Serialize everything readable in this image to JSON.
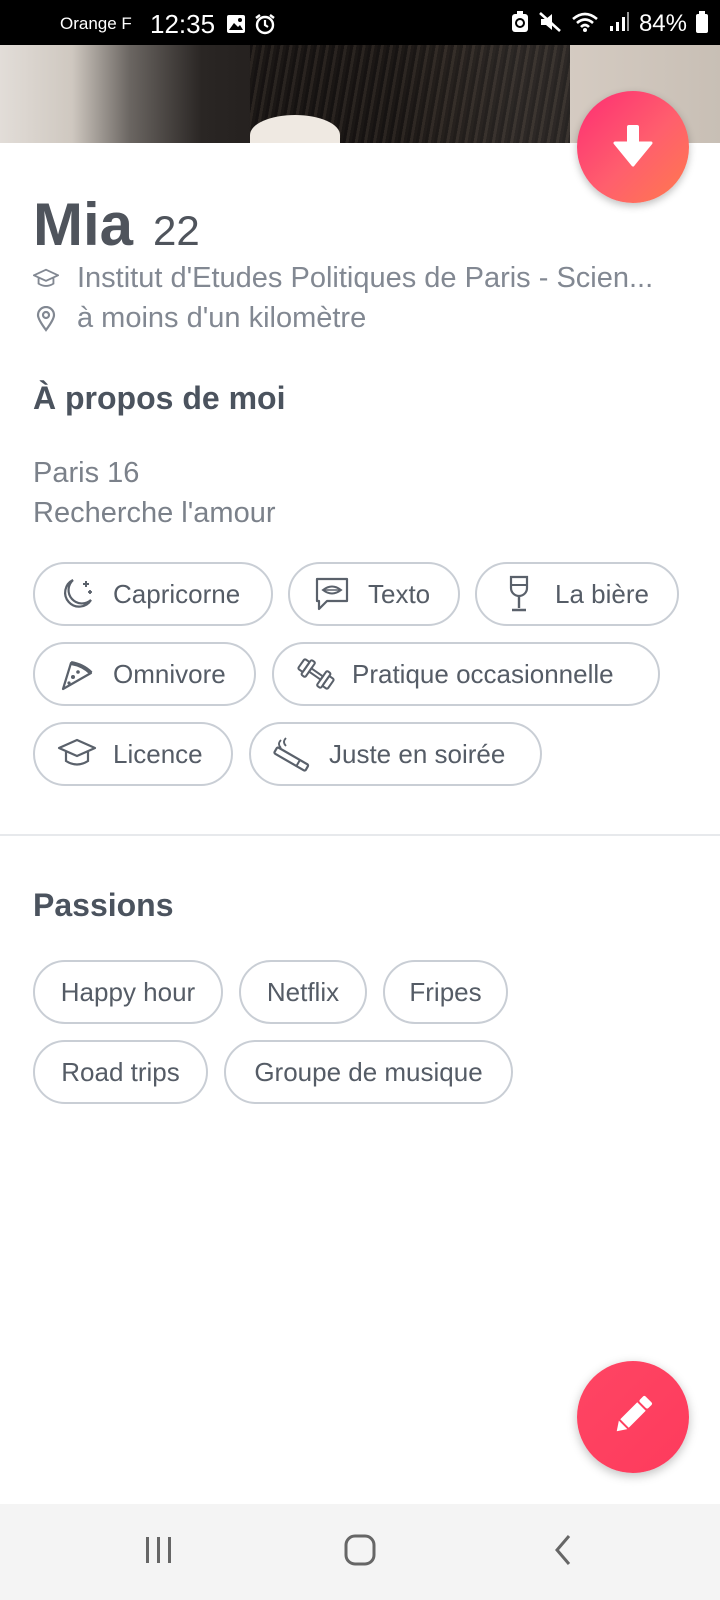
{
  "status_bar": {
    "carrier": "Orange F",
    "time": "12:35",
    "battery": "84%",
    "icons": [
      "gallery-icon",
      "alarm-icon",
      "battery-saver-icon",
      "mute-icon",
      "wifi-icon",
      "signal-icon",
      "battery-icon"
    ]
  },
  "profile": {
    "name": "Mia",
    "age": "22",
    "school": "Institut d'Etudes Politiques de Paris - Scien...",
    "distance": "à moins d'un kilomètre"
  },
  "about": {
    "title": "À propos de moi",
    "bio_line1": "Paris 16",
    "bio_line2": "Recherche l'amour",
    "chips": [
      {
        "label": "Capricorne",
        "icon": "moon-stars-icon"
      },
      {
        "label": "Texto",
        "icon": "chat-lips-icon"
      },
      {
        "label": "La bière",
        "icon": "wine-glass-icon"
      },
      {
        "label": "Omnivore",
        "icon": "pizza-slice-icon"
      },
      {
        "label": "Pratique occasionnelle",
        "icon": "dumbbell-icon"
      },
      {
        "label": "Licence",
        "icon": "graduation-cap-icon"
      },
      {
        "label": "Juste en soirée",
        "icon": "cigarette-icon"
      }
    ]
  },
  "passions": {
    "title": "Passions",
    "items": [
      "Happy hour",
      "Netflix",
      "Fripes",
      "Road trips",
      "Groupe de musique"
    ]
  },
  "colors": {
    "accent_gradient_start": "#fd2d73",
    "accent_gradient_end": "#ff7a4d",
    "text_dark": "#4f545c",
    "text_muted": "#828892",
    "chip_border": "#c9ced5"
  }
}
